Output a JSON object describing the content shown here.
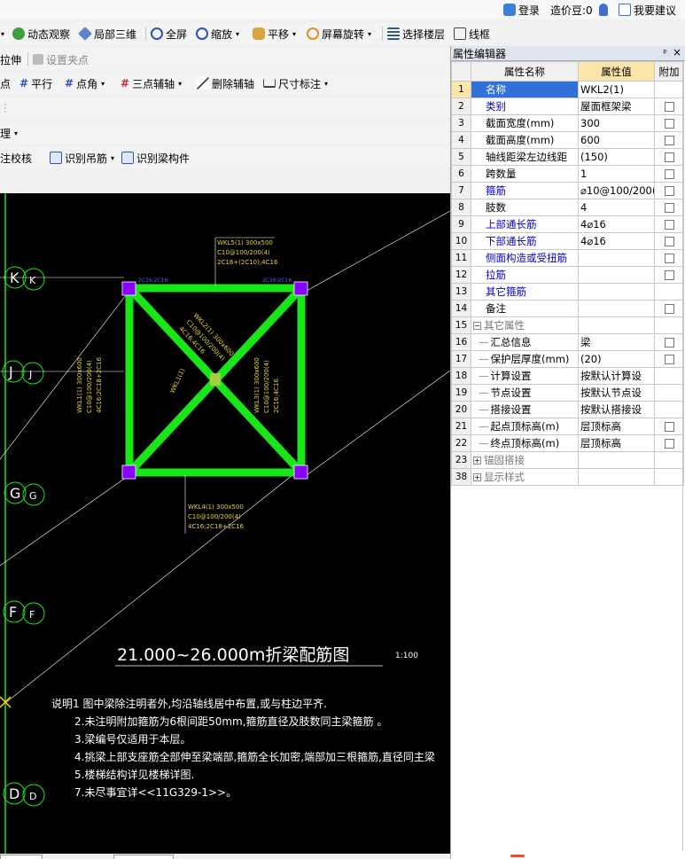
{
  "topbar": {
    "login": "登录",
    "bean": "造价豆:0",
    "suggest": "我要建议"
  },
  "toolbar1": {
    "dynamic_view": "动态观察",
    "local_3d": "局部三维",
    "fullscreen": "全屏",
    "zoom": "缩放",
    "pan": "平移",
    "rotate": "屏幕旋转",
    "select_floor": "选择楼层",
    "wireframe": "线框"
  },
  "toolbar2": {
    "stretch": "拉伸",
    "set_grip": "设置夹点"
  },
  "toolbar3": {
    "point": "画点",
    "parallel": "平行",
    "point_angle": "点角",
    "three_point_axis": "三点辅轴",
    "delete_axis": "删除辅轴",
    "dimension": "尺寸标注"
  },
  "toolbar5": {
    "manage": "管理"
  },
  "toolbar6": {
    "annotation_check": "标注校核",
    "identify_hanger": "识别吊筋",
    "identify_beam": "识别梁构件"
  },
  "cad": {
    "axes": [
      "K",
      "J",
      "G",
      "F",
      "D"
    ],
    "title": "21.000~26.000m折梁配筋图",
    "scale": "1:100",
    "notes": [
      "说明1 图中梁除注明者外,均沿轴线居中布置,或与柱边平齐.",
      "2.未注明附加箍筋为6根间距50mm,箍筋直径及肢数同主梁箍筋 。",
      "3.梁编号仅适用于本层。",
      "4.挑梁上部支座筋全部伸至梁端部,箍筋全长加密,端部加三根箍筋,直径同主梁",
      "5.楼梯结构详见楼梯详图.",
      "7.未尽事宜详<<11G329-1>>。"
    ],
    "beam_top": [
      "WKL5(1) 300x500",
      "C10@100/200(4)",
      "2C18+(2C10);4C16"
    ],
    "beam_bottom": [
      "WKL4(1) 300x500",
      "C10@100/200(4)",
      "4C16;2C18+2C16"
    ],
    "beam_left": [
      "WKL1(1) 300x600",
      "C10@100/200(4)",
      "4C16;2C18+2C16"
    ],
    "beam_right": [
      "WKL3(1) 300x600",
      "C10@100/200(4)",
      "2C16;4C16"
    ],
    "beam_diag": [
      "WKL2(1) 300x600",
      "C10@100/200(4)",
      "4C16;4C16"
    ],
    "beam_center": "WKL1(1)",
    "beam_top_marks": [
      "2C16;2C16",
      "2C16;2C16"
    ]
  },
  "property_editor": {
    "title": "属性编辑器",
    "pin": "ᵖ",
    "close": "×",
    "col_name": "属性名称",
    "col_value": "属性值",
    "col_add": "附加",
    "rows": [
      {
        "no": "1",
        "name": "名称",
        "value": "WKL2(1)"
      },
      {
        "no": "2",
        "name": "类别",
        "value": "屋面框架梁"
      },
      {
        "no": "3",
        "name": "截面宽度(mm)",
        "value": "300"
      },
      {
        "no": "4",
        "name": "截面高度(mm)",
        "value": "600"
      },
      {
        "no": "5",
        "name": "轴线距梁左边线距",
        "value": "(150)"
      },
      {
        "no": "6",
        "name": "跨数量",
        "value": "1"
      },
      {
        "no": "7",
        "name": "箍筋",
        "value": "⌀10@100/200("
      },
      {
        "no": "8",
        "name": "肢数",
        "value": "4"
      },
      {
        "no": "9",
        "name": "上部通长筋",
        "value": "4⌀16"
      },
      {
        "no": "10",
        "name": "下部通长筋",
        "value": "4⌀16"
      },
      {
        "no": "11",
        "name": "侧面构造或受扭筋",
        "value": ""
      },
      {
        "no": "12",
        "name": "拉筋",
        "value": ""
      },
      {
        "no": "13",
        "name": "其它箍筋",
        "value": ""
      },
      {
        "no": "14",
        "name": "备注",
        "value": ""
      },
      {
        "no": "15",
        "name": "其它属性",
        "value": ""
      },
      {
        "no": "16",
        "name": "汇总信息",
        "value": "梁"
      },
      {
        "no": "17",
        "name": "保护层厚度(mm)",
        "value": "(20)"
      },
      {
        "no": "18",
        "name": "计算设置",
        "value": "按默认计算设"
      },
      {
        "no": "19",
        "name": "节点设置",
        "value": "按默认节点设"
      },
      {
        "no": "20",
        "name": "搭接设置",
        "value": "按默认搭接设"
      },
      {
        "no": "21",
        "name": "起点顶标高(m)",
        "value": "层顶标高"
      },
      {
        "no": "22",
        "name": "终点顶标高(m)",
        "value": "层顶标高"
      },
      {
        "no": "23",
        "name": "锚固搭接",
        "value": ""
      },
      {
        "no": "38",
        "name": "显示样式",
        "value": ""
      }
    ]
  },
  "colors": {
    "beam": "#19e619",
    "column": "#8a00ff",
    "selection": "#3170d6",
    "header_value": "#fce5a8"
  }
}
